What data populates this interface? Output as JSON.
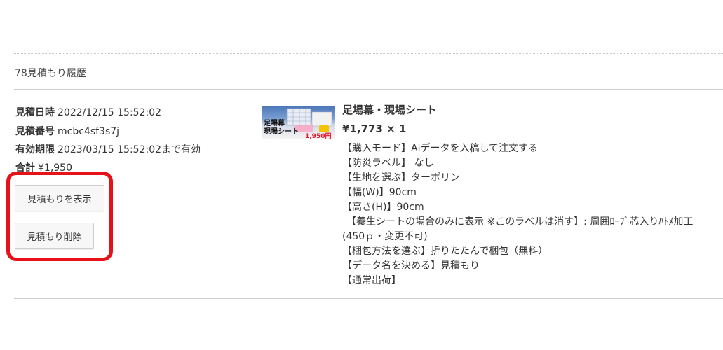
{
  "history": {
    "title": "78見積もり履歴"
  },
  "estimate": {
    "date_label": "見積日時",
    "date_value": "2022/12/15 15:52:02",
    "number_label": "見積番号",
    "number_value": "mcbc4sf3s7j",
    "expiry_label": "有効期限",
    "expiry_value": "2023/03/15 15:52:02まで有効",
    "total_label": "合計",
    "total_value": "¥1,950"
  },
  "buttons": {
    "show_label": "見積もりを表示",
    "delete_label": "見積もり削除"
  },
  "highlight_color": "#e8111a",
  "product": {
    "thumb_line1": "足場幕",
    "thumb_line2": "現場シート",
    "thumb_price": "1,950円~",
    "name": "足場幕・現場シート",
    "price_qty": "¥1,773 × 1",
    "options": [
      "【購入モード】Aiデータを入稿して注文する",
      "【防炎ラベル】 なし",
      "【生地を選ぶ】ターポリン",
      "【幅(W)】90cm",
      "【高さ(H)】90cm",
      "【養生シートの場合のみに表示 ※このラベルは消す】: 周囲ﾛｰﾌﾟ芯入りﾊﾄﾒ加工",
      "(450ｐ・変更不可)",
      "【梱包方法を選ぶ】折りたたんで梱包（無料）",
      "【データ名を決める】見積もり",
      "【通常出荷】"
    ]
  }
}
